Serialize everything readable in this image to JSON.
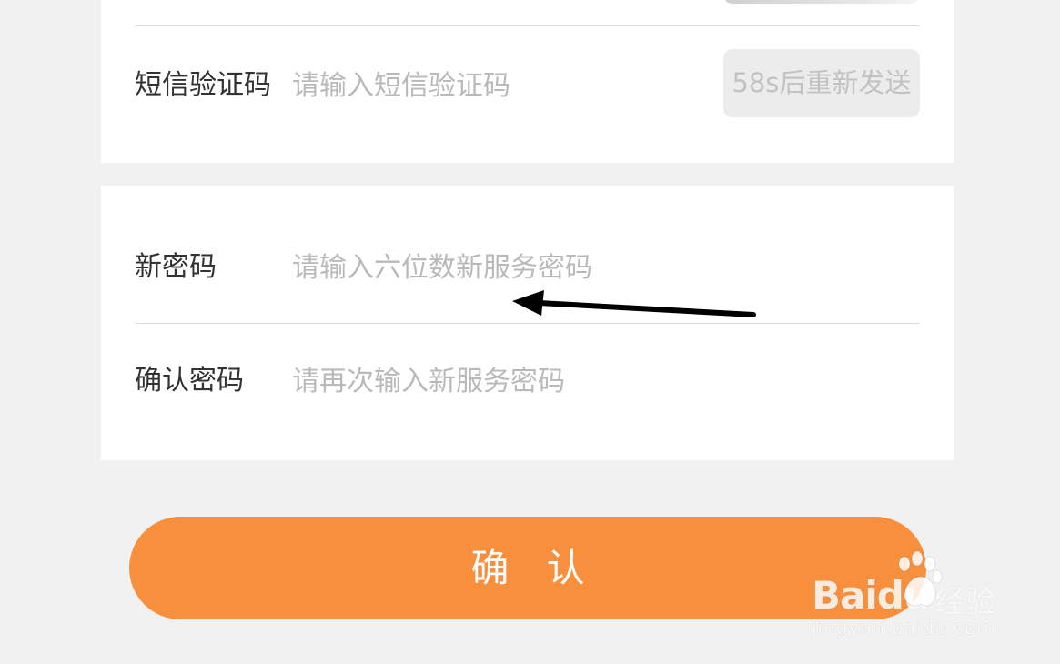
{
  "form": {
    "sms_code": {
      "label": "短信验证码",
      "placeholder": "请输入短信验证码",
      "value": "",
      "resend_label": "58s后重新发送"
    },
    "new_password": {
      "label": "新密码",
      "placeholder": "请输入六位数新服务密码",
      "value": ""
    },
    "confirm_password": {
      "label": "确认密码",
      "placeholder": "请再次输入新服务密码",
      "value": ""
    }
  },
  "confirm_button": {
    "label": "确 认"
  },
  "watermark": {
    "brand": "Baidu",
    "product": "经验",
    "url": "jingyan.baidu.com"
  },
  "colors": {
    "background": "#f1f1f1",
    "card": "#ffffff",
    "accent": "#f78f3d",
    "placeholder": "#b9b9b9",
    "label": "#333333",
    "disabled_button_bg": "#ececec",
    "disabled_button_text": "#c2c2c2"
  }
}
